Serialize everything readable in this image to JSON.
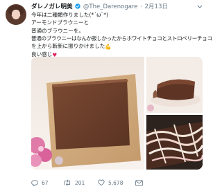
{
  "tweet": {
    "author": {
      "name": "ダレノガレ明美",
      "verified_icon": "verified-badge-icon",
      "handle": "@The_Darenogare",
      "date": "2月13日"
    },
    "text_lines": [
      "今年は二種類作りました(*´ω`*)",
      "アーモンドブラウニーと",
      "普通のブラウニーを。",
      "普通のブラウニーはなんか寂しかったからホワイトチョコとストロベリーチョコ",
      "を上から斬新に振りかけました",
      "良い感じ"
    ],
    "inline_emoji": {
      "muscle": "💪",
      "heart": "♥"
    },
    "media": [
      {
        "kind": "photo",
        "subject": "square brownie on wooden board with pink flowers"
      },
      {
        "kind": "photo",
        "subject": "chocolate loaf cake"
      },
      {
        "kind": "photo",
        "subject": "brownie drizzled with white and strawberry chocolate"
      }
    ],
    "actions": {
      "reply": {
        "icon": "reply-icon",
        "count": "67"
      },
      "retweet": {
        "icon": "retweet-icon",
        "count": "201"
      },
      "like": {
        "icon": "heart-icon",
        "count": "5,678"
      },
      "dm": {
        "icon": "envelope-icon",
        "count": ""
      }
    }
  },
  "colors": {
    "text": "#14171a",
    "secondary": "#657786",
    "verified": "#1da1f2",
    "heart": "#e0245e"
  }
}
